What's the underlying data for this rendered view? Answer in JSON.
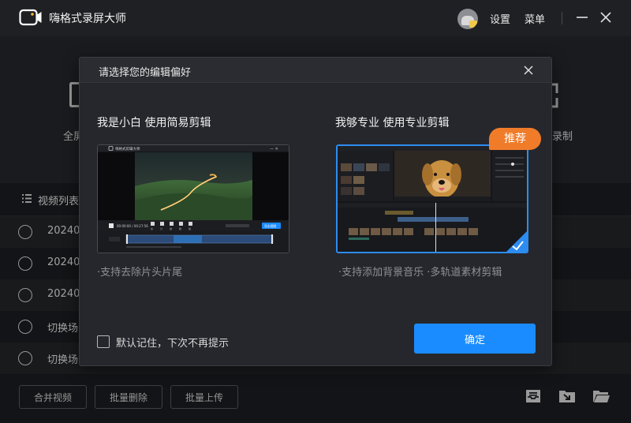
{
  "app": {
    "title": "嗨格式录屏大师"
  },
  "titlebar": {
    "settings_label": "设置",
    "menu_label": "菜单"
  },
  "background": {
    "mode_left_label": "全屏",
    "mode_right_label": "录制",
    "list_title": "视频列表",
    "rows": [
      {
        "text": "20240"
      },
      {
        "text": "20240"
      },
      {
        "text": "20240"
      },
      {
        "text": "切换场"
      },
      {
        "text": "切换场"
      }
    ],
    "buttons": {
      "merge": "合并视频",
      "batch_delete": "批量删除",
      "batch_upload": "批量上传"
    }
  },
  "dialog": {
    "title": "请选择您的编辑偏好",
    "simple": {
      "title": "我是小白 使用简易剪辑",
      "desc": "·支持去除片头片尾"
    },
    "pro": {
      "title": "我够专业 使用专业剪辑",
      "desc": "·支持添加背景音乐 ·多轨道素材剪辑",
      "badge": "推荐"
    },
    "remember_label": "默认记住，下次不再提示",
    "confirm_label": "确定"
  },
  "preview": {
    "simple_title": "嗨格式剪辑大师",
    "simple_time": "00:00:00 / 00:27:56",
    "simple_export": "导出视频",
    "simple_tools": [
      "剪",
      "分",
      "撤",
      "删",
      "播"
    ]
  },
  "colors": {
    "accent": "#1a8cff",
    "badge": "#f07c2a",
    "selected_border": "#2d8cf0"
  }
}
